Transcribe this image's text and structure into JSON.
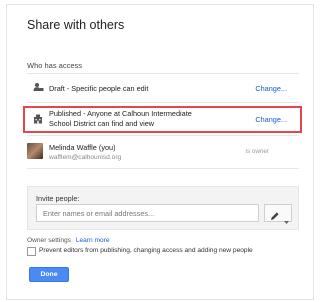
{
  "dialog": {
    "title": "Share with others",
    "who_has_access": "Who has access"
  },
  "access_rows": [
    {
      "icon": "person-restricted-icon",
      "text": "Draft - Specific people can edit",
      "link": "Change..."
    },
    {
      "icon": "building-icon",
      "text_line1": "Published - Anyone at Calhoun Intermediate",
      "text_line2": "School District can find and view",
      "link": "Change..."
    },
    {
      "icon": "avatar",
      "name": "Melinda Waffle (you)",
      "email": "wafflem@calhounisd.org",
      "role": "is owner"
    }
  ],
  "invite": {
    "label": "Invite people:",
    "placeholder": "Enter names or email addresses...",
    "perm_icon": "pencil-icon"
  },
  "owner_settings": {
    "label": "Owner settings",
    "learn_more": "Learn more",
    "checkbox_label": "Prevent editors from publishing, changing access and adding new people",
    "checked": false
  },
  "done_label": "Done",
  "colors": {
    "link": "#1a5ad6",
    "highlight": "#e2474c",
    "primary": "#4a8af4"
  }
}
